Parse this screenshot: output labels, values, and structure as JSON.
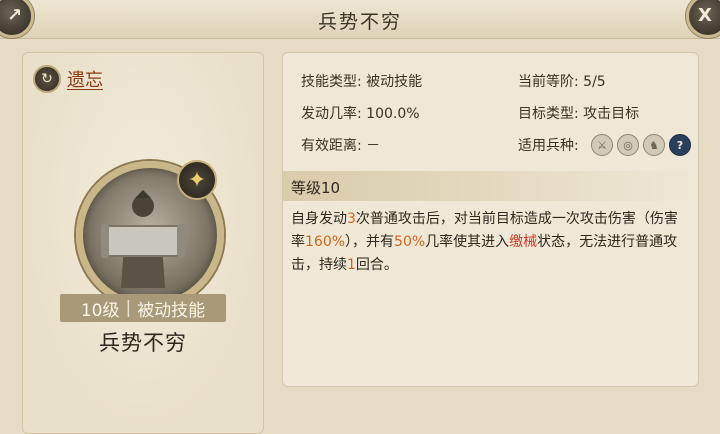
{
  "header": {
    "title": "兵势不穷"
  },
  "left_panel": {
    "forget_label": "遗忘",
    "level": "10级",
    "separator": "|",
    "skill_type": "被动技能",
    "skill_name": "兵势不穷"
  },
  "info": {
    "skill_type_label": "技能类型:",
    "skill_type_value": "被动技能",
    "rank_label": "当前等阶:",
    "rank_value": "5/5",
    "trigger_label": "发动几率:",
    "trigger_value": "100.0%",
    "target_label": "目标类型:",
    "target_value": "攻击目标",
    "range_label": "有效距离:",
    "range_value": "－",
    "troop_label": "适用兵种:",
    "troop_icons": [
      "sword-troop-icon",
      "bow-troop-icon",
      "horse-troop-icon",
      "question-icon"
    ]
  },
  "level_section": {
    "title": "等级10"
  },
  "description": {
    "p1": "自身发动",
    "n1": "3",
    "p2": "次普通攻击后，对当前目标造成一次攻击伤害（伤害率",
    "n2": "160%",
    "p3": "），并有",
    "n3": "50%",
    "p4": "几率使其进入",
    "status": "缴械",
    "p5": "状态，无法进行普通攻击，持续",
    "n4": "1",
    "p6": "回合。"
  },
  "colors": {
    "highlight": "#d2651c",
    "status": "#cf3b2a",
    "forget": "#8a3a12"
  }
}
